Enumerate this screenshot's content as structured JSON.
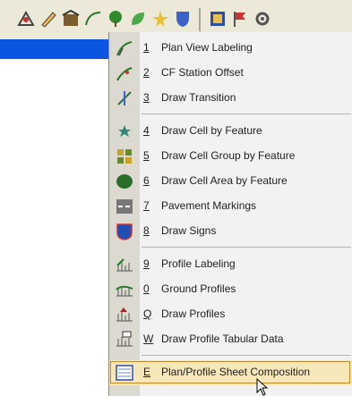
{
  "menu": {
    "items": [
      {
        "accel": "1",
        "label": "Plan View Labeling",
        "icon": "plan-labeling-icon"
      },
      {
        "accel": "2",
        "label": "CF Station Offset",
        "icon": "station-offset-icon"
      },
      {
        "accel": "3",
        "label": "Draw Transition",
        "icon": "transition-icon"
      },
      {
        "accel": "4",
        "label": "Draw Cell by Feature",
        "icon": "cell-feature-icon"
      },
      {
        "accel": "5",
        "label": "Draw Cell Group by Feature",
        "icon": "cell-group-icon"
      },
      {
        "accel": "6",
        "label": "Draw Cell Area by Feature",
        "icon": "cell-area-icon"
      },
      {
        "accel": "7",
        "label": "Pavement Markings",
        "icon": "pavement-markings-icon"
      },
      {
        "accel": "8",
        "label": "Draw Signs",
        "icon": "signs-icon"
      },
      {
        "accel": "9",
        "label": "Profile Labeling",
        "icon": "profile-labeling-icon"
      },
      {
        "accel": "0",
        "label": "Ground Profiles",
        "icon": "ground-profiles-icon"
      },
      {
        "accel": "Q",
        "label": "Draw Profiles",
        "icon": "draw-profiles-icon"
      },
      {
        "accel": "W",
        "label": "Draw Profile Tabular Data",
        "icon": "tabular-data-icon"
      },
      {
        "accel": "E",
        "label": "Plan/Profile Sheet Composition",
        "icon": "sheet-composition-icon"
      }
    ]
  },
  "colors": {
    "title_bar": "#0a54e0",
    "selection": "#f6e7b8"
  }
}
